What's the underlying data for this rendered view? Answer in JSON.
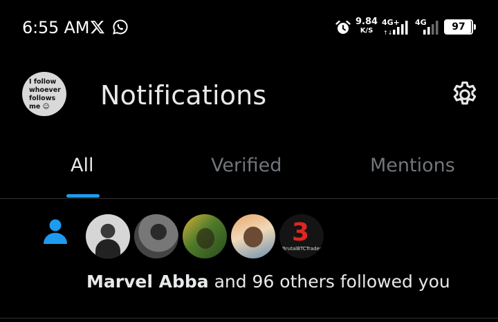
{
  "status_bar": {
    "time": "6:55 AM",
    "app_icons": [
      "x-logo-icon",
      "whatsapp-icon"
    ],
    "alarm_icon": "alarm-clock-icon",
    "net_speed_value": "9.84",
    "net_speed_unit": "K/S",
    "sim1_label": "4G+",
    "sim2_label": "4G",
    "battery_percent": "97",
    "battery_level": 0.97
  },
  "header": {
    "avatar_text": "I follow whoever follows me ☺",
    "title": "Notifications",
    "settings_icon": "gear-icon"
  },
  "tabs": [
    {
      "label": "All",
      "active": true
    },
    {
      "label": "Verified",
      "active": false
    },
    {
      "label": "Mentions",
      "active": false
    }
  ],
  "notification": {
    "icon": "person-icon",
    "avatar_caption": "BrutalBTCTrades",
    "actor": "Marvel Abba",
    "rest": " and 96 others followed you"
  },
  "colors": {
    "accent": "#1d9bf0",
    "background": "#000000",
    "text_primary": "#e7e9ea",
    "text_secondary": "#71767b"
  }
}
